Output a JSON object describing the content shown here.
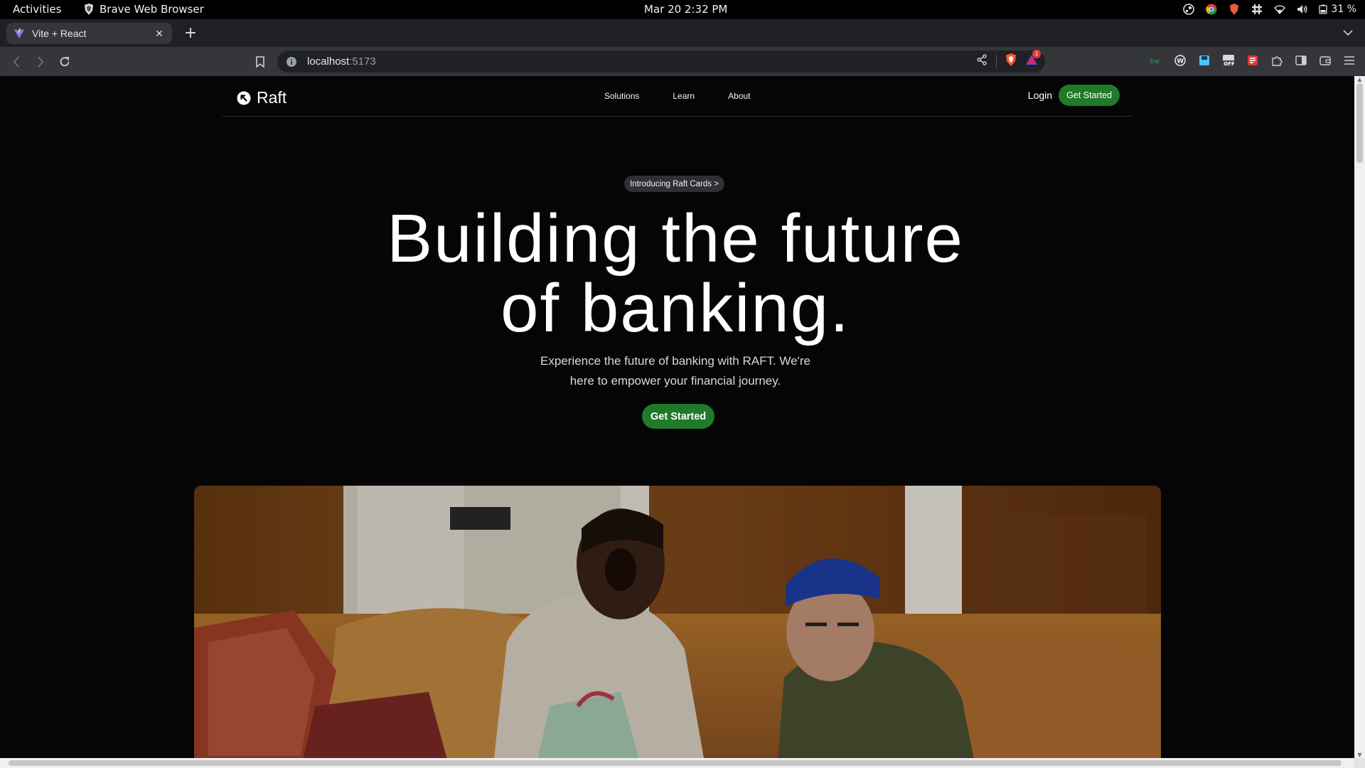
{
  "system_bar": {
    "activities": "Activities",
    "app_name": "Brave Web Browser",
    "datetime": "Mar 20  2:32 PM",
    "battery": "31 %"
  },
  "browser": {
    "tab_title": "Vite + React",
    "url_host": "localhost",
    "url_port": ":5173",
    "rewards_badge": "1"
  },
  "site": {
    "brand": "Raft",
    "nav": [
      "Solutions",
      "Learn",
      "About"
    ],
    "login": "Login",
    "get_started": "Get Started",
    "pill": "Introducing Raft Cards >",
    "hero_title_line1": "Building the future",
    "hero_title_line2": "of banking.",
    "hero_sub_line1": "Experience the future of banking with RAFT. We're",
    "hero_sub_line2": "here to empower your financial journey.",
    "hero_cta": "Get Started"
  },
  "colors": {
    "accent_green": "#1f7a2a",
    "page_bg": "#050505",
    "brave_orange": "#fb542b"
  }
}
